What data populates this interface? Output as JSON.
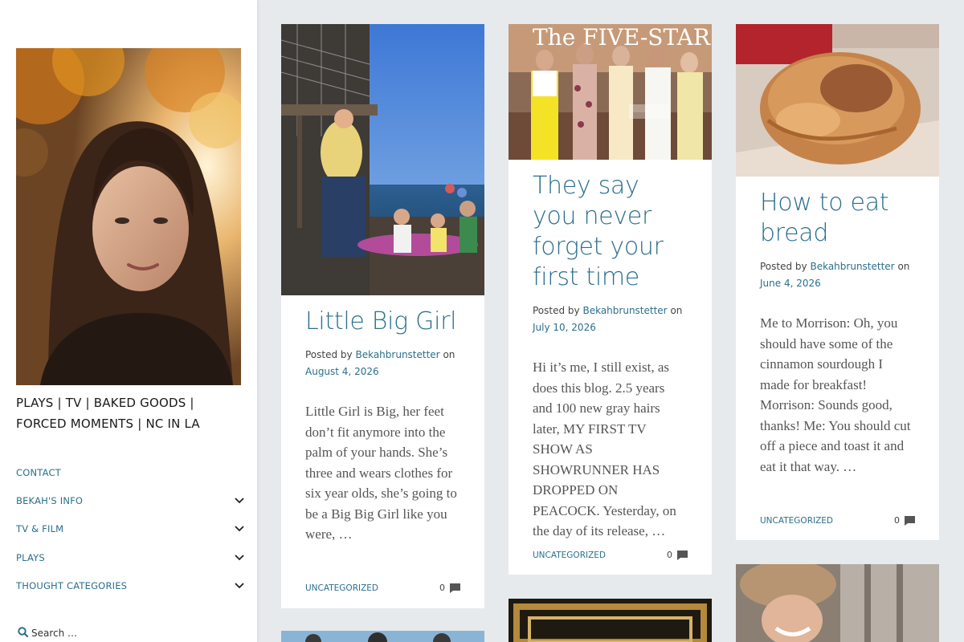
{
  "sidebar": {
    "description": "PLAYS | TV | BAKED GOODS | FORCED MOMENTS | NC IN LA",
    "nav": [
      {
        "label": "CONTACT",
        "has_submenu": false
      },
      {
        "label": "BEKAH'S INFO",
        "has_submenu": true
      },
      {
        "label": "TV & FILM",
        "has_submenu": true
      },
      {
        "label": "PLAYS",
        "has_submenu": true
      },
      {
        "label": "THOUGHT CATEGORIES",
        "has_submenu": true
      }
    ],
    "search_placeholder": "Search …",
    "search_icon": "search-icon"
  },
  "posts": [
    {
      "title": "Little Big Girl",
      "posted_by": "Posted by",
      "author": "Bekahbrunstetter",
      "on": "on",
      "date": "August 4, 2026",
      "excerpt": "Little Girl is Big, her feet don’t fit anymore into the palm of your hands. She’s three and wears clothes for six year olds, she’s going to be a Big Big Girl like you were, …",
      "category": "UNCATEGORIZED",
      "comment_count": "0"
    },
    {
      "title": "They say you never forget your first time",
      "posted_by": "Posted by",
      "author": "Bekahbrunstetter",
      "on": "on",
      "date": "July 10, 2026",
      "excerpt": "Hi it’s me, I still exist, as does this blog. 2.5 years and 100 new gray hairs later, MY FIRST TV SHOW AS SHOWRUNNER HAS DROPPED ON PEACOCK. Yesterday, on the day of its release, …",
      "category": "UNCATEGORIZED",
      "comment_count": "0",
      "image_text": "The FIVE-STAR WEEKEND"
    },
    {
      "title": "How to eat bread",
      "posted_by": "Posted by",
      "author": "Bekahbrunstetter",
      "on": "on",
      "date": "June 4, 2026",
      "excerpt": "Me to Morrison: Oh, you should have some of the cinnamon sourdough I made for breakfast! Morrison: Sounds good, thanks! Me: You should cut off a piece and toast it and eat it that way. …",
      "category": "UNCATEGORIZED",
      "comment_count": "0"
    }
  ],
  "colors": {
    "link": "#2b6f8c",
    "background": "#e6eaed",
    "card": "#ffffff"
  }
}
